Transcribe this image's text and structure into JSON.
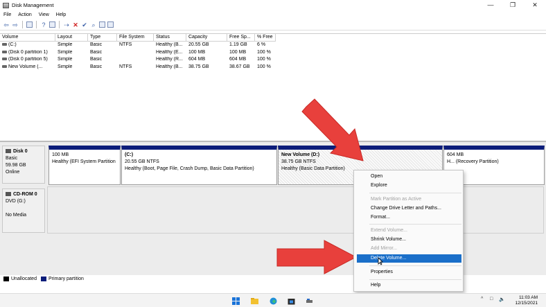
{
  "window": {
    "title": "Disk Management",
    "controls": [
      "—",
      "❐",
      "✕"
    ]
  },
  "menu": [
    "File",
    "Action",
    "View",
    "Help"
  ],
  "toolbar_icons": [
    "back-icon",
    "forward-icon",
    "disk-list-icon",
    "help-icon",
    "properties-icon",
    "connect-icon",
    "delete-icon",
    "check-icon",
    "search-icon",
    "format-icon",
    "list-icon"
  ],
  "volume_table": {
    "columns": [
      "Volume",
      "Layout",
      "Type",
      "File System",
      "Status",
      "Capacity",
      "Free Sp...",
      "% Free"
    ],
    "rows": [
      [
        "(C:)",
        "Simple",
        "Basic",
        "NTFS",
        "Healthy (B...",
        "20.55 GB",
        "1.19 GB",
        "6 %"
      ],
      [
        "(Disk 0 partition 1)",
        "Simple",
        "Basic",
        "",
        "Healthy (E...",
        "100 MB",
        "100 MB",
        "100 %"
      ],
      [
        "(Disk 0 partition 5)",
        "Simple",
        "Basic",
        "",
        "Healthy (R...",
        "604 MB",
        "604 MB",
        "100 %"
      ],
      [
        "New Volume (...",
        "Simple",
        "Basic",
        "NTFS",
        "Healthy (B...",
        "38.75 GB",
        "38.67 GB",
        "100 %"
      ]
    ]
  },
  "disk0": {
    "name": "Disk 0",
    "type": "Basic",
    "size": "59.98 GB",
    "state": "Online",
    "partitions": [
      {
        "name": "",
        "size": "100 MB",
        "status": "Healthy (EFI System Partition"
      },
      {
        "name": "(C:)",
        "size": "20.55 GB NTFS",
        "status": "Healthy (Boot, Page File, Crash Dump, Basic Data Partition)"
      },
      {
        "name": "New Volume  (D:)",
        "size": "38.75 GB NTFS",
        "status": "Healthy (Basic Data Partition)"
      },
      {
        "name": "",
        "size": "604 MB",
        "status": "H... (Recovery Partition)"
      }
    ]
  },
  "cdrom0": {
    "name": "CD-ROM 0",
    "type": "DVD (G:)",
    "media": "No Media"
  },
  "legend": {
    "unallocated": "Unallocated",
    "primary": "Primary partition",
    "colors": {
      "unallocated": "#000000",
      "primary": "#0c1d7a"
    }
  },
  "context_menu": {
    "items": [
      {
        "label": "Open",
        "enabled": true
      },
      {
        "label": "Explore",
        "enabled": true
      },
      {
        "label": "Mark Partition as Active",
        "enabled": false
      },
      {
        "label": "Change Drive Letter and Paths...",
        "enabled": true
      },
      {
        "label": "Format...",
        "enabled": true
      },
      {
        "label": "Extend Volume...",
        "enabled": false
      },
      {
        "label": "Shrink Volume...",
        "enabled": true
      },
      {
        "label": "Add Mirror...",
        "enabled": false
      },
      {
        "label": "Delete Volume...",
        "enabled": true,
        "highlighted": true
      },
      {
        "label": "Properties",
        "enabled": true
      },
      {
        "label": "Help",
        "enabled": true
      }
    ],
    "highlight_color": "#1a6fc9"
  },
  "taskbar": {
    "icons": [
      "windows-start-icon",
      "file-explorer-icon",
      "edge-icon",
      "store-icon",
      "disk-management-icon"
    ],
    "tray": [
      "^",
      "□",
      "🔈"
    ],
    "time": "11:03 AM",
    "date": "12/15/2021"
  },
  "annotation_color": "#e8403c"
}
